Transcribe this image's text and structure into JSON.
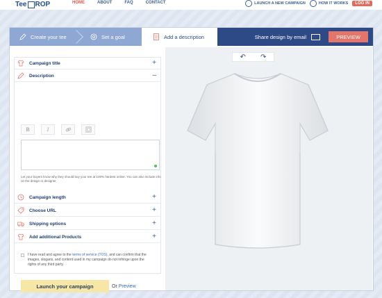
{
  "header": {
    "logo_text": "Tee4Drop",
    "logo_left": "Tee",
    "logo_right": "ROP",
    "nav": [
      "HOME",
      "ABOUT",
      "FAQ",
      "CONTACT"
    ],
    "launch_campaign": "LAUNCH A NEW CAMPAIGN",
    "how_it_works": "HOW IT WORKS",
    "login": "LOG IN"
  },
  "steps": {
    "create_tee": "Create your tee",
    "set_goal": "Set a goal",
    "add_description": "Add a description",
    "share_by_email": "Share design by email",
    "preview": "PREVIEW"
  },
  "panel": {
    "campaign_title": "Campaign title",
    "description": "Description",
    "toolbar": {
      "bold": "B",
      "italic": "I"
    },
    "help_text": "Let your buyers know why they should buy your tee at 100% hardest online. You can also include info on the design or designer.",
    "campaign_length": "Campaign length",
    "choose_url": "Choose URL",
    "shipping_options": "Shipping options",
    "add_products": "Add additional Products",
    "plus": "+",
    "minus": "–",
    "terms_pre": "I have read and agree to the ",
    "terms_link": "terms of service (TOS)",
    "terms_post": ", and can confirm that the images, slogans, and content used in my campaign do not infringe upon the rights of any third party.",
    "launch_btn": "Launch your campaign",
    "or": "Or",
    "preview_link": "Preview"
  },
  "design": {
    "undo": "↶",
    "redo": "↷"
  },
  "colors": {
    "stepbar": "#2e4a86",
    "step_inactive": "#8ea7d3",
    "accent_red": "#e5746a",
    "launch_yellow": "#f7e7a6"
  }
}
